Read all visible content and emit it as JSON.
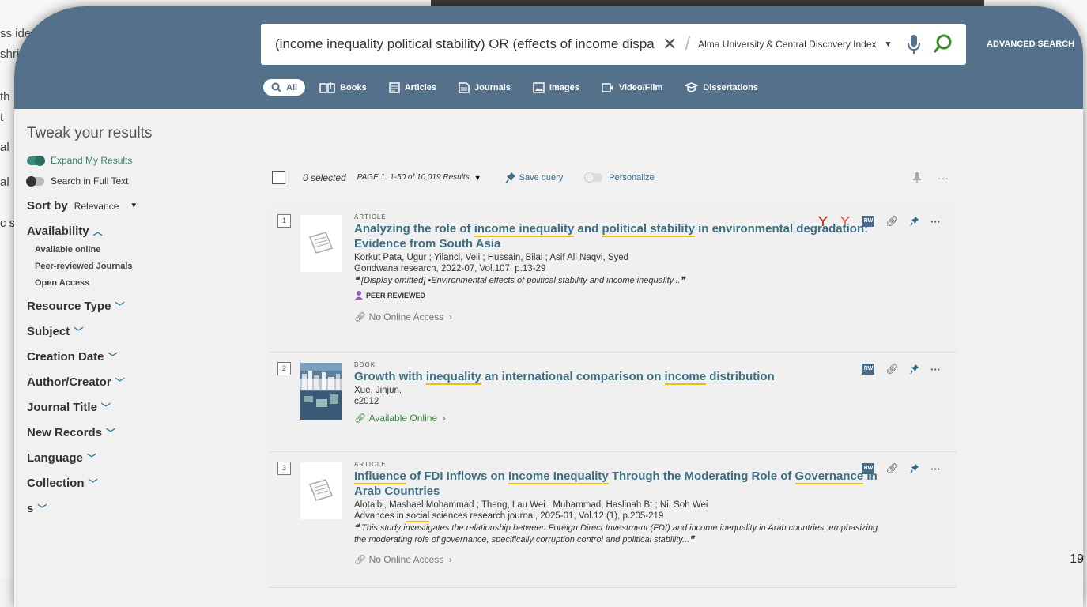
{
  "slide": {
    "fragments": [
      "ss iden",
      "shri",
      "th",
      "t",
      "al",
      "al",
      "c s"
    ],
    "page_number": "19"
  },
  "header": {
    "query": "(income inequality political stability) OR (effects of income disparity",
    "scope": "Alma University & Central Discovery Index",
    "advanced": "ADVANCED SEARCH",
    "tabs": [
      "All",
      "Books",
      "Articles",
      "Journals",
      "Images",
      "Video/Film",
      "Dissertations"
    ]
  },
  "sidebar": {
    "title": "Tweak your results",
    "toggles": [
      "Expand My Results",
      "Search in Full Text"
    ],
    "sort_label": "Sort by",
    "sort_value": "Relevance",
    "availability": "Availability",
    "availability_items": [
      "Available online",
      "Peer-reviewed Journals",
      "Open Access"
    ],
    "facets": [
      "Resource Type",
      "Subject",
      "Creation Date",
      "Author/Creator",
      "Journal Title",
      "New Records",
      "Language",
      "Collection",
      "s"
    ]
  },
  "toolbar": {
    "selected": "0 selected",
    "page": "PAGE 1",
    "results": "1-50 of 10,019 Results",
    "save_query": "Save query",
    "personalize": "Personalize"
  },
  "results": [
    {
      "num": "1",
      "type": "ARTICLE",
      "authors": "Korkut Pata, Ugur ; Yilanci, Veli ; Hussain, Bilal ; Asif Ali Naqvi, Syed",
      "source": "Gondwana research, 2022-07, Vol.107, p.13-29",
      "snippet": "[Display omitted] •Environmental effects of political stability and income inequality...",
      "peer": "PEER REVIEWED",
      "access": "No Online Access"
    },
    {
      "num": "2",
      "type": "BOOK",
      "authors": "Xue, Jinjun.",
      "source": "c2012",
      "access": "Available Online"
    },
    {
      "num": "3",
      "type": "ARTICLE",
      "authors": "Alotaibi, Mashael Mohammad ; Theng, Lau Wei ; Muhammad, Haslinah Bt ; Ni, Soh Wei",
      "snippet": "This study investigates the relationship between Foreign Direct Investment (FDI) and income inequality in Arab countries, emphasizing the moderating role of governance, specifically corruption control and political stability...",
      "access": "No Online Access"
    }
  ],
  "colors": {
    "header": "#54708a",
    "title": "#3c6e83",
    "highlight": "#e8c100"
  }
}
